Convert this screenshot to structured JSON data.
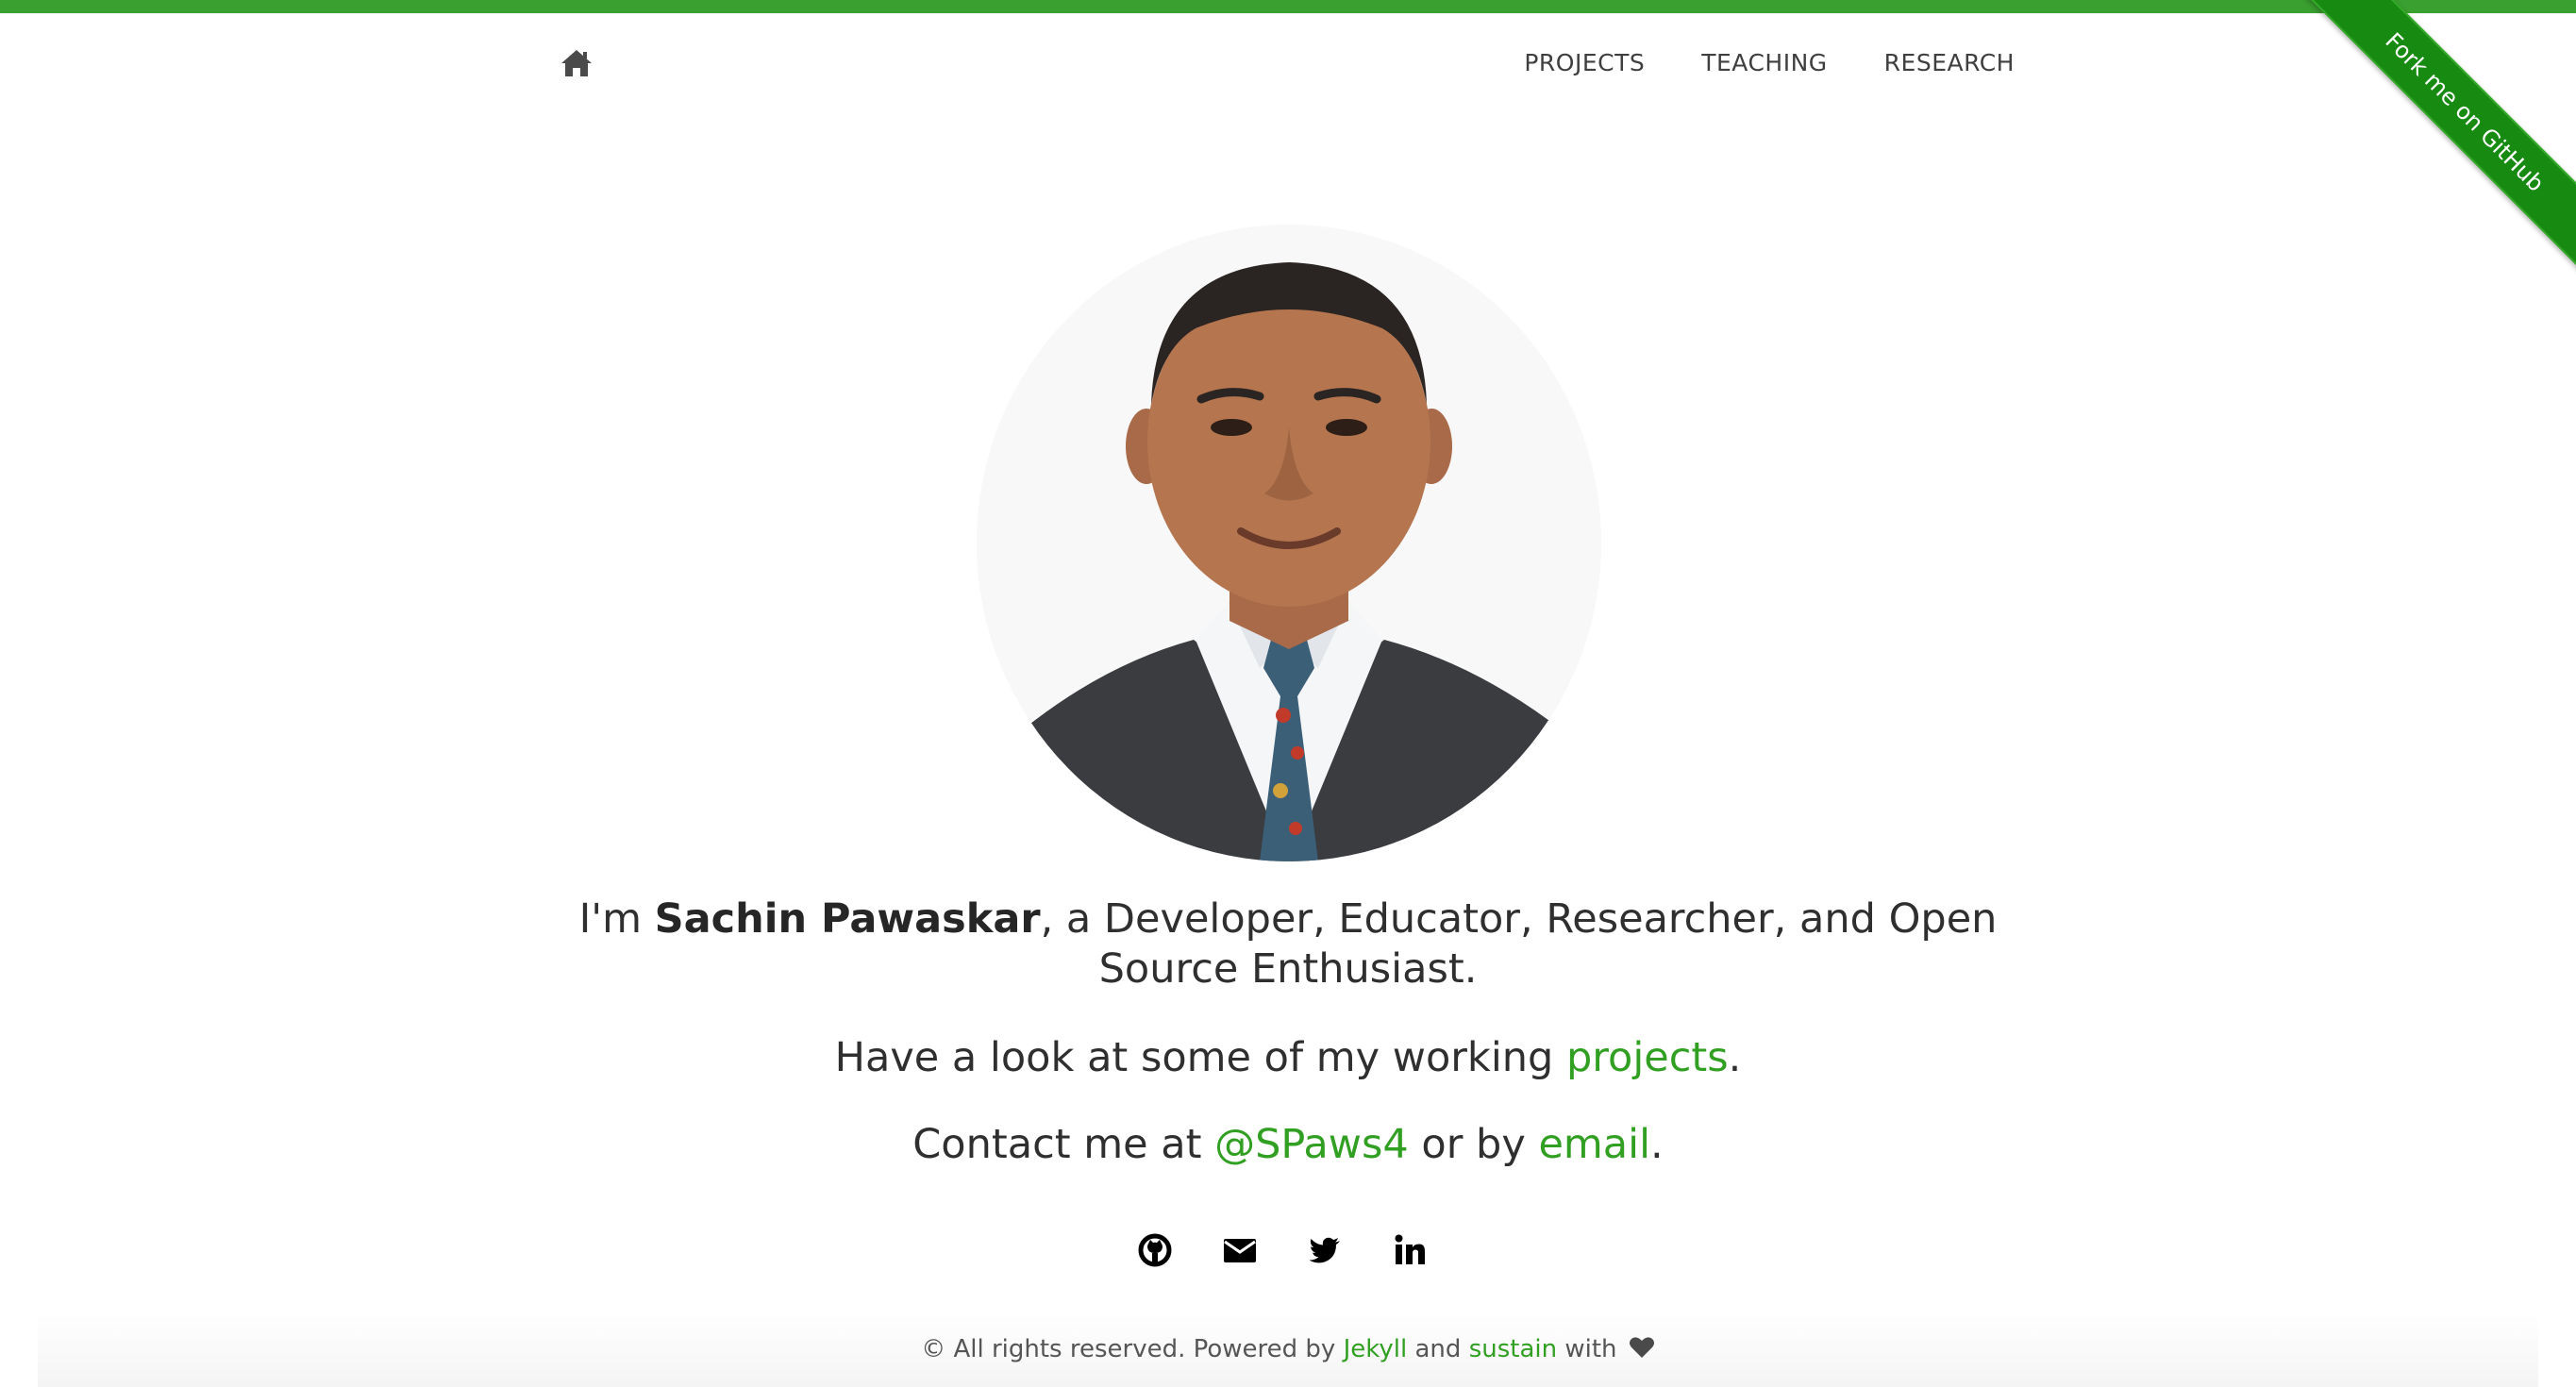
{
  "nav": {
    "home_icon": "home-icon",
    "items": [
      {
        "label": "PROJECTS"
      },
      {
        "label": "TEACHING"
      },
      {
        "label": "RESEARCH"
      }
    ]
  },
  "ribbon": {
    "label": "Fork me on GitHub",
    "color": "#178a11"
  },
  "portrait": {
    "icon": "profile-photo"
  },
  "intro": {
    "prefix": "I'm ",
    "name": "Sachin Pawaskar",
    "suffix": ", a Developer, Educator, Researcher, and Open Source Enthusiast."
  },
  "projects_line": {
    "prefix": "Have a look at some of my working ",
    "link": "projects",
    "suffix": "."
  },
  "contact_line": {
    "prefix": "Contact me at ",
    "handle": "@SPaws4",
    "middle": " or by ",
    "email_link": "email",
    "suffix": "."
  },
  "social": [
    {
      "icon": "github-icon"
    },
    {
      "icon": "envelope-icon"
    },
    {
      "icon": "twitter-icon"
    },
    {
      "icon": "linkedin-icon"
    }
  ],
  "footer": {
    "prefix": "© All rights reserved. Powered by ",
    "jekyll": "Jekyll",
    "and": " and ",
    "sustain": "sustain",
    "with": " with ",
    "heart_icon": "heart-icon"
  },
  "colors": {
    "accent": "#31a022",
    "top_bar": "#3aa02f",
    "text": "#2f2f2f"
  }
}
